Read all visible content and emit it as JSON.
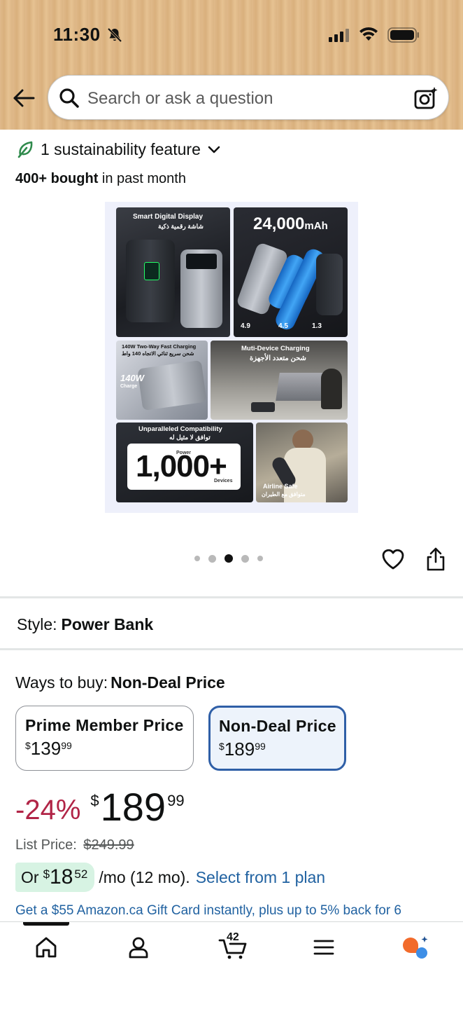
{
  "status_bar": {
    "time": "11:30",
    "icons": [
      "bell-slash-icon",
      "cellular-signal-icon",
      "wifi-icon",
      "battery-icon"
    ]
  },
  "header": {
    "background": "#dfb887",
    "search": {
      "placeholder": "Search or ask a question"
    }
  },
  "product": {
    "sustainability": "1 sustainability feature",
    "bought_count": "400+ bought",
    "bought_suffix": " in past month",
    "image_tiles": {
      "display": {
        "title": "Smart Digital Display",
        "subtitle": "شاشة رقمية ذكية"
      },
      "capacity": {
        "value": "24,000",
        "unit": "mAh",
        "stats": [
          "4.9",
          "4.5",
          "1.3"
        ]
      },
      "charging": {
        "title": "140W Two-Way Fast Charging",
        "subtitle": "شحن سريع ثنائي الاتجاه 140 واط",
        "badge": "140W",
        "badge_sub": "Charge"
      },
      "multi": {
        "title": "Muti-Device Charging",
        "subtitle": "شحن متعدد الأجهزة"
      },
      "compat": {
        "title": "Unparalleled Compatibility",
        "subtitle": "توافق لا مثيل له",
        "number": "1,000+",
        "power": "Power",
        "devices": "Devices"
      },
      "airline": {
        "title": "Airline Safe",
        "subtitle": "متوافق مع الطيران"
      }
    },
    "carousel": {
      "count": 5,
      "active_index": 2
    }
  },
  "style": {
    "label": "Style:",
    "value": "Power Bank"
  },
  "ways_to_buy": {
    "label": "Ways to buy:",
    "selected": "Non-Deal Price",
    "options": [
      {
        "title": "Prime Member Price",
        "currency": "$",
        "whole": "139",
        "fraction": "99"
      },
      {
        "title": "Non-Deal Price",
        "currency": "$",
        "whole": "189",
        "fraction": "99"
      }
    ]
  },
  "price": {
    "discount": "-24%",
    "currency": "$",
    "whole": "189",
    "fraction": "99",
    "list_label": "List Price:",
    "list_value": "$249.99",
    "discount_color": "#b12446"
  },
  "monthly": {
    "or": "Or",
    "currency": "$",
    "whole": "18",
    "fraction": "52",
    "term": "/mo (12 mo).",
    "link": "Select from 1 plan"
  },
  "gift_offer": "Get a $55 Amazon.ca Gift Card instantly, plus up to 5% back for 6",
  "bottom_nav": {
    "cart_count": "42",
    "items": [
      "home-icon",
      "account-icon",
      "cart-icon",
      "menu-icon",
      "rufus-assistant-icon"
    ]
  },
  "colors": {
    "link": "#2162a1",
    "selected_border": "#2f5fa7",
    "pill_green": "#d7f3e3"
  }
}
